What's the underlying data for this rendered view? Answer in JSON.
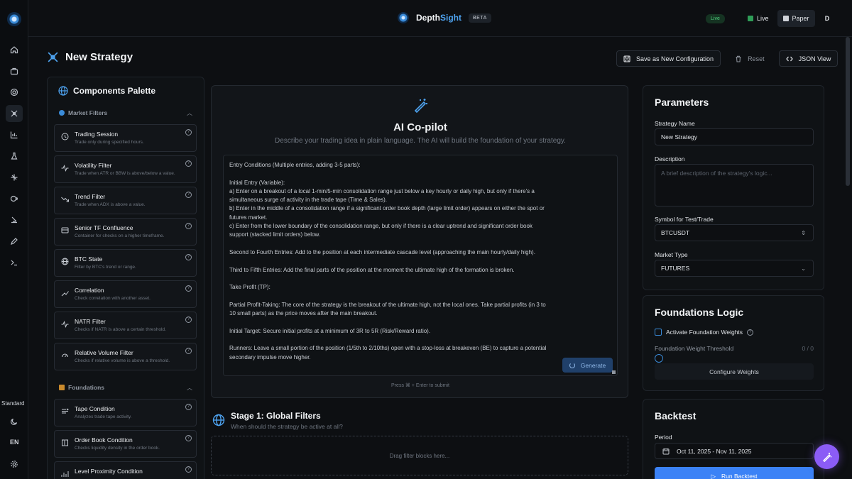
{
  "brand": {
    "name_a": "Depth",
    "name_b": "Sight",
    "badge": "BETA"
  },
  "topbar": {
    "status": "Live",
    "modes": [
      {
        "label": "Live",
        "color": "#2e9d57"
      },
      {
        "label": "Paper",
        "color": "#d0d4da"
      }
    ],
    "avatar": "D"
  },
  "rail": {
    "plan": "Standard",
    "lang": "EN",
    "icons": [
      "home-icon",
      "briefcase-icon",
      "target-icon",
      "strategy-icon",
      "chart-icon",
      "flask-icon",
      "sparkle-icon",
      "brain-icon",
      "bot-icon",
      "pencil-icon",
      "terminal-icon",
      "moon-icon",
      "settings-icon"
    ]
  },
  "page": {
    "title": "New Strategy"
  },
  "actions": {
    "save": "Save as New Configuration",
    "reset": "Reset",
    "json": "JSON View"
  },
  "palette": {
    "title": "Components Palette",
    "market_filters_label": "Market Filters",
    "foundations_label": "Foundations",
    "market_filters": [
      {
        "title": "Trading Session",
        "desc": "Trade only during specified hours.",
        "icon": "clock-icon"
      },
      {
        "title": "Volatility Filter",
        "desc": "Trade when ATR or BBW is above/below a value.",
        "icon": "pulse-icon"
      },
      {
        "title": "Trend Filter",
        "desc": "Trade when ADX is above a value.",
        "icon": "trend-icon"
      },
      {
        "title": "Senior TF Confluence",
        "desc": "Container for checks on a higher timeframe.",
        "icon": "layers-icon"
      },
      {
        "title": "BTC State",
        "desc": "Filter by BTC's trend or range.",
        "icon": "globe-icon"
      },
      {
        "title": "Correlation",
        "desc": "Check correlation with another asset.",
        "icon": "link-icon"
      },
      {
        "title": "NATR Filter",
        "desc": "Checks if NATR is above a certain threshold.",
        "icon": "pulse-icon"
      },
      {
        "title": "Relative Volume Filter",
        "desc": "Checks if relative volume is above a threshold.",
        "icon": "gauge-icon"
      }
    ],
    "foundations": [
      {
        "title": "Tape Condition",
        "desc": "Analyzes trade tape activity.",
        "icon": "tape-icon"
      },
      {
        "title": "Order Book Condition",
        "desc": "Checks liquidity density in the order book.",
        "icon": "book-icon"
      },
      {
        "title": "Level Proximity Condition",
        "desc": "",
        "icon": "bars-icon"
      }
    ]
  },
  "copilot": {
    "title": "AI Co-pilot",
    "subtitle": "Describe your trading idea in plain language. The AI will build the foundation of your strategy.",
    "text": "Entry Conditions (Multiple entries, adding 3-5 parts):\n\nInitial Entry (Variable):\na) Enter on a breakout of a local 1-min/5-min consolidation range just below a key hourly or daily high, but only if there's a simultaneous surge of activity in the trade tape (Time & Sales).\nb) Enter in the middle of a consolidation range if a significant order book depth (large limit order) appears on either the spot or futures market.\nc) Enter from the lower boundary of the consolidation range, but only if there is a clear uptrend and significant order book support (stacked limit orders) below.\n\nSecond to Fourth Entries: Add to the position at each intermediate cascade level (approaching the main hourly/daily high).\n\nThird to Fifth Entries: Add the final parts of the position at the moment the ultimate high of the formation is broken.\n\nTake Profit (TP):\n\nPartial Profit-Taking: The core of the strategy is the breakout of the ultimate high, not the local ones. Take partial profits (in 3 to 10 small parts) as the price moves after the main breakout.\n\nInitial Target: Secure initial profits at a minimum of 3R to 5R (Risk/Reward ratio).\n\nRunners: Leave a small portion of the position (1/5th to 2/10ths) open with a stop-loss at breakeven (BE) to capture a potential secondary impulse move higher.",
    "generate": "Generate",
    "hint": "Press ⌘ + Enter to submit"
  },
  "stage1": {
    "title": "Stage 1: Global Filters",
    "subtitle": "When should the strategy be active at all?",
    "drop": "Drag filter blocks here..."
  },
  "parameters": {
    "title": "Parameters",
    "name_label": "Strategy Name",
    "name_value": "New Strategy",
    "desc_label": "Description",
    "desc_placeholder": "A brief description of the strategy's logic...",
    "symbol_label": "Symbol for Test/Trade",
    "symbol_value": "BTCUSDT",
    "market_label": "Market Type",
    "market_value": "FUTURES"
  },
  "foundations_logic": {
    "title": "Foundations Logic",
    "activate": "Activate Foundation Weights",
    "threshold_label": "Foundation Weight Threshold",
    "threshold_value": "0 / 0",
    "configure": "Configure Weights"
  },
  "backtest": {
    "title": "Backtest",
    "period_label": "Period",
    "period_value": "Oct 11, 2025 - Nov 11, 2025",
    "run": "Run Backtest"
  }
}
